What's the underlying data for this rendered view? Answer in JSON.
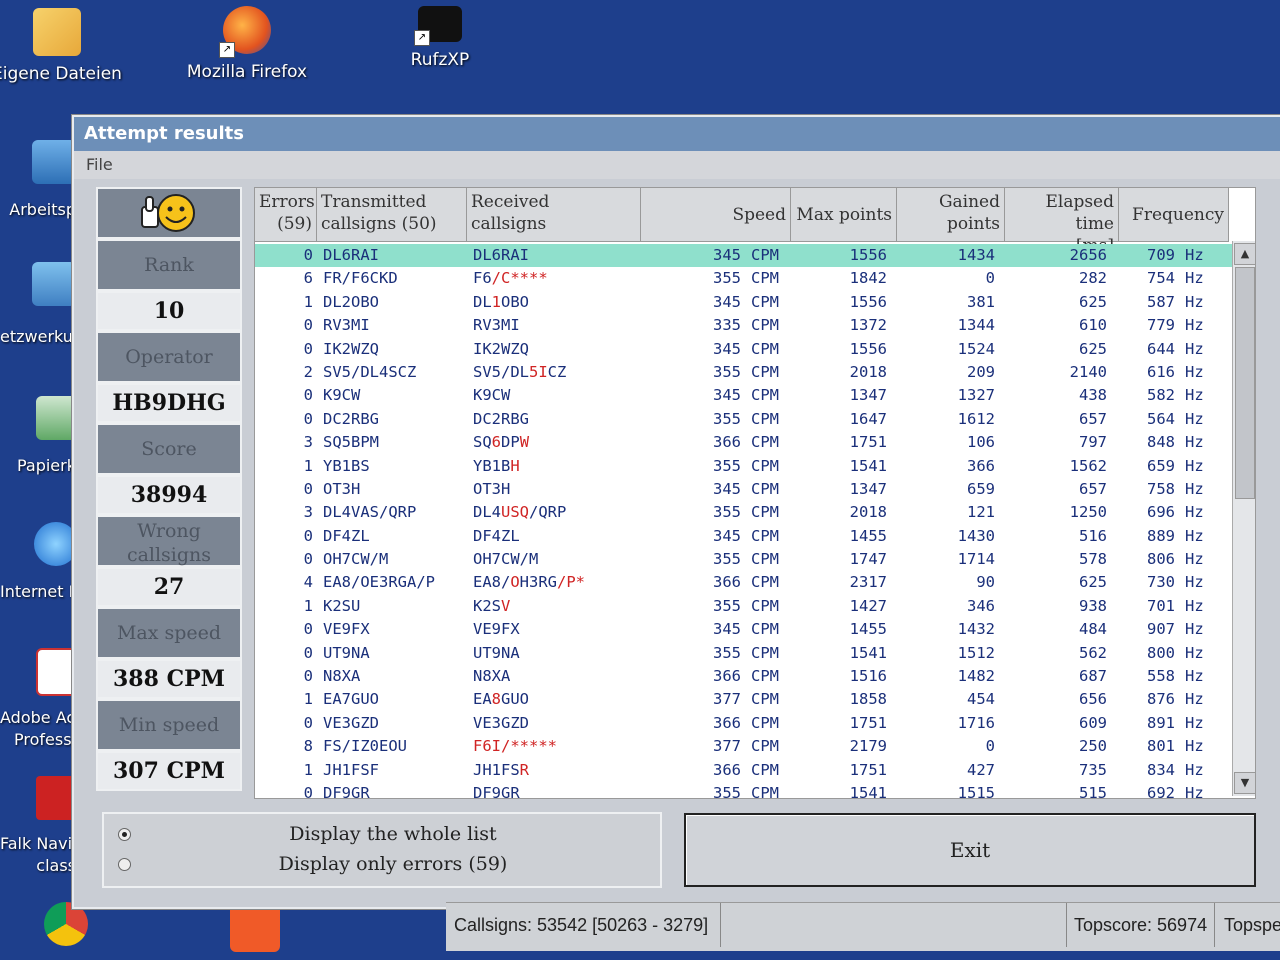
{
  "desktop": {
    "top_icons": [
      {
        "label": "Eigene Dateien",
        "icon": "folder-envelope-icon"
      },
      {
        "label": "Mozilla Firefox",
        "icon": "firefox-icon"
      },
      {
        "label": "RufzXP",
        "icon": "rufzxp-icon"
      }
    ],
    "side_icons": [
      {
        "label": "Arbeitsp",
        "icon": "computer-icon"
      },
      {
        "label": "etzwerkum",
        "icon": "network-icon"
      },
      {
        "label": "Papierk",
        "icon": "recycle-bin-icon"
      },
      {
        "label": "Internet E",
        "icon": "internet-explorer-icon"
      },
      {
        "label": "Adobe Acr",
        "label2": "Professi",
        "icon": "adobe-acrobat-icon"
      },
      {
        "label": "Falk Navi-M",
        "label2": "class",
        "icon": "falk-navi-icon"
      }
    ]
  },
  "window": {
    "title": "Attempt results",
    "menu": [
      "File"
    ]
  },
  "left_panel": {
    "rank_label": "Rank",
    "rank_value": "10",
    "operator_label": "Operator",
    "operator_value": "HB9DHG",
    "score_label": "Score",
    "score_value": "38994",
    "wrong_label_1": "Wrong",
    "wrong_label_2": "callsigns",
    "wrong_value": "27",
    "max_speed_label": "Max speed",
    "max_speed_value": "388 CPM",
    "min_speed_label": "Min speed",
    "min_speed_value": "307 CPM"
  },
  "table": {
    "headers": {
      "errors": "Errors\n(59)",
      "transmitted": "Transmitted\ncallsigns (50)",
      "received": "Received\ncallsigns",
      "speed": "Speed",
      "max_points": "Max points",
      "gained": "Gained\npoints",
      "elapsed": "Elapsed time\n[ms]",
      "frequency": "Frequency"
    },
    "rows": [
      {
        "err": "0",
        "tx": "DL6RAI",
        "rx": [
          [
            "DL6RAI",
            0
          ]
        ],
        "speed": "345",
        "max": "1556",
        "gain": "1434",
        "ms": "2656",
        "freq": "709"
      },
      {
        "err": "6",
        "tx": "FR/F6CKD",
        "rx": [
          [
            "F6",
            0
          ],
          [
            "/C****",
            1
          ]
        ],
        "speed": "355",
        "max": "1842",
        "gain": "0",
        "ms": "282",
        "freq": "754"
      },
      {
        "err": "1",
        "tx": "DL2OBO",
        "rx": [
          [
            "DL",
            0
          ],
          [
            "1",
            1
          ],
          [
            "OBO",
            0
          ]
        ],
        "speed": "345",
        "max": "1556",
        "gain": "381",
        "ms": "625",
        "freq": "587"
      },
      {
        "err": "0",
        "tx": "RV3MI",
        "rx": [
          [
            "RV3MI",
            0
          ]
        ],
        "speed": "335",
        "max": "1372",
        "gain": "1344",
        "ms": "610",
        "freq": "779"
      },
      {
        "err": "0",
        "tx": "IK2WZQ",
        "rx": [
          [
            "IK2WZQ",
            0
          ]
        ],
        "speed": "345",
        "max": "1556",
        "gain": "1524",
        "ms": "625",
        "freq": "644"
      },
      {
        "err": "2",
        "tx": "SV5/DL4SCZ",
        "rx": [
          [
            "SV5/DL",
            0
          ],
          [
            "5I",
            1
          ],
          [
            "CZ",
            0
          ]
        ],
        "speed": "355",
        "max": "2018",
        "gain": "209",
        "ms": "2140",
        "freq": "616"
      },
      {
        "err": "0",
        "tx": "K9CW",
        "rx": [
          [
            "K9CW",
            0
          ]
        ],
        "speed": "345",
        "max": "1347",
        "gain": "1327",
        "ms": "438",
        "freq": "582"
      },
      {
        "err": "0",
        "tx": "DC2RBG",
        "rx": [
          [
            "DC2RBG",
            0
          ]
        ],
        "speed": "355",
        "max": "1647",
        "gain": "1612",
        "ms": "657",
        "freq": "564"
      },
      {
        "err": "3",
        "tx": "SQ5BPM",
        "rx": [
          [
            "SQ",
            0
          ],
          [
            "6",
            1
          ],
          [
            "DP",
            0
          ],
          [
            "W",
            1
          ]
        ],
        "speed": "366",
        "max": "1751",
        "gain": "106",
        "ms": "797",
        "freq": "848"
      },
      {
        "err": "1",
        "tx": "YB1BS",
        "rx": [
          [
            "YB1B",
            0
          ],
          [
            "H",
            1
          ]
        ],
        "speed": "355",
        "max": "1541",
        "gain": "366",
        "ms": "1562",
        "freq": "659"
      },
      {
        "err": "0",
        "tx": "OT3H",
        "rx": [
          [
            "OT3H",
            0
          ]
        ],
        "speed": "345",
        "max": "1347",
        "gain": "659",
        "ms": "657",
        "freq": "758"
      },
      {
        "err": "3",
        "tx": "DL4VAS/QRP",
        "rx": [
          [
            "DL4",
            0
          ],
          [
            "USQ",
            1
          ],
          [
            "/QRP",
            0
          ]
        ],
        "speed": "355",
        "max": "2018",
        "gain": "121",
        "ms": "1250",
        "freq": "696"
      },
      {
        "err": "0",
        "tx": "DF4ZL",
        "rx": [
          [
            "DF4ZL",
            0
          ]
        ],
        "speed": "345",
        "max": "1455",
        "gain": "1430",
        "ms": "516",
        "freq": "889"
      },
      {
        "err": "0",
        "tx": "OH7CW/M",
        "rx": [
          [
            "OH7CW/M",
            0
          ]
        ],
        "speed": "355",
        "max": "1747",
        "gain": "1714",
        "ms": "578",
        "freq": "806"
      },
      {
        "err": "4",
        "tx": "EA8/OE3RGA/P",
        "rx": [
          [
            "EA8/",
            0
          ],
          [
            "O",
            1
          ],
          [
            "H3RG",
            0
          ],
          [
            "/P*",
            1
          ]
        ],
        "speed": "366",
        "max": "2317",
        "gain": "90",
        "ms": "625",
        "freq": "730"
      },
      {
        "err": "1",
        "tx": "K2SU",
        "rx": [
          [
            "K2S",
            0
          ],
          [
            "V",
            1
          ]
        ],
        "speed": "355",
        "max": "1427",
        "gain": "346",
        "ms": "938",
        "freq": "701"
      },
      {
        "err": "0",
        "tx": "VE9FX",
        "rx": [
          [
            "VE9FX",
            0
          ]
        ],
        "speed": "345",
        "max": "1455",
        "gain": "1432",
        "ms": "484",
        "freq": "907"
      },
      {
        "err": "0",
        "tx": "UT9NA",
        "rx": [
          [
            "UT9NA",
            0
          ]
        ],
        "speed": "355",
        "max": "1541",
        "gain": "1512",
        "ms": "562",
        "freq": "800"
      },
      {
        "err": "0",
        "tx": "N8XA",
        "rx": [
          [
            "N8XA",
            0
          ]
        ],
        "speed": "366",
        "max": "1516",
        "gain": "1482",
        "ms": "687",
        "freq": "558"
      },
      {
        "err": "1",
        "tx": "EA7GUO",
        "rx": [
          [
            "EA",
            0
          ],
          [
            "8",
            1
          ],
          [
            "GUO",
            0
          ]
        ],
        "speed": "377",
        "max": "1858",
        "gain": "454",
        "ms": "656",
        "freq": "876"
      },
      {
        "err": "0",
        "tx": "VE3GZD",
        "rx": [
          [
            "VE3GZD",
            0
          ]
        ],
        "speed": "366",
        "max": "1751",
        "gain": "1716",
        "ms": "609",
        "freq": "891"
      },
      {
        "err": "8",
        "tx": "FS/IZ0EOU",
        "rx": [
          [
            "F6I/*****",
            1
          ]
        ],
        "speed": "377",
        "max": "2179",
        "gain": "0",
        "ms": "250",
        "freq": "801"
      },
      {
        "err": "1",
        "tx": "JH1FSF",
        "rx": [
          [
            "JH1FS",
            0
          ],
          [
            "R",
            1
          ]
        ],
        "speed": "366",
        "max": "1751",
        "gain": "427",
        "ms": "735",
        "freq": "834"
      },
      {
        "err": "0",
        "tx": "DF9GR",
        "rx": [
          [
            "DF9GR",
            0
          ]
        ],
        "speed": "355",
        "max": "1541",
        "gain": "1515",
        "ms": "515",
        "freq": "692"
      }
    ],
    "cpm_unit": "CPM",
    "hz_unit": "Hz"
  },
  "options": {
    "whole_list": "Display the whole list",
    "only_errors": "Display only errors (59)",
    "selected": "whole_list"
  },
  "exit_label": "Exit",
  "status": {
    "callsigns": "Callsigns: 53542 [50263 - 3279]",
    "topscore": "Topscore: 56974",
    "topspeed": "Topspe"
  },
  "colors": {
    "desktop": "#1e3f8c",
    "title_bar": "#6d8fb8",
    "selected_row": "#8fe0cc",
    "received_error": "#d02424",
    "callsign_text": "#1a2f7a"
  }
}
